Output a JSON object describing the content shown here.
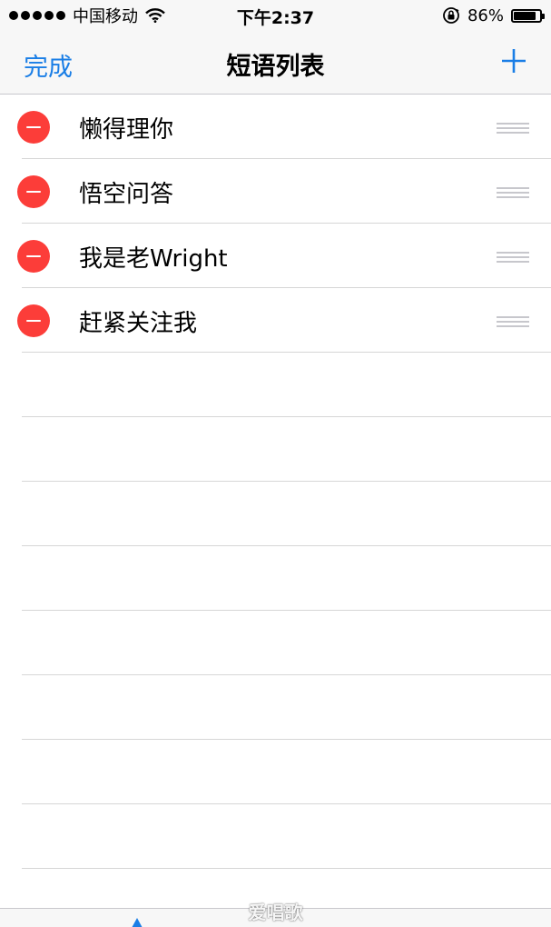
{
  "status_bar": {
    "carrier": "中国移动",
    "time": "下午2:37",
    "battery_percent": "86%",
    "battery_level": 0.86,
    "icons": [
      "signal-icon",
      "wifi-icon",
      "orientation-lock-icon",
      "battery-icon"
    ]
  },
  "nav": {
    "done_label": "完成",
    "title": "短语列表",
    "add_icon": "plus-icon",
    "accent_color": "#1a7ee6"
  },
  "phrases": [
    {
      "text": "懒得理你"
    },
    {
      "text": "悟空问答"
    },
    {
      "text": "我是老Wright"
    },
    {
      "text": "赶紧关注我"
    }
  ],
  "row_icons": {
    "delete": "minus-circle-icon",
    "reorder": "reorder-handle-icon",
    "delete_color": "#fc3d39"
  },
  "watermark": "爱唱歌"
}
